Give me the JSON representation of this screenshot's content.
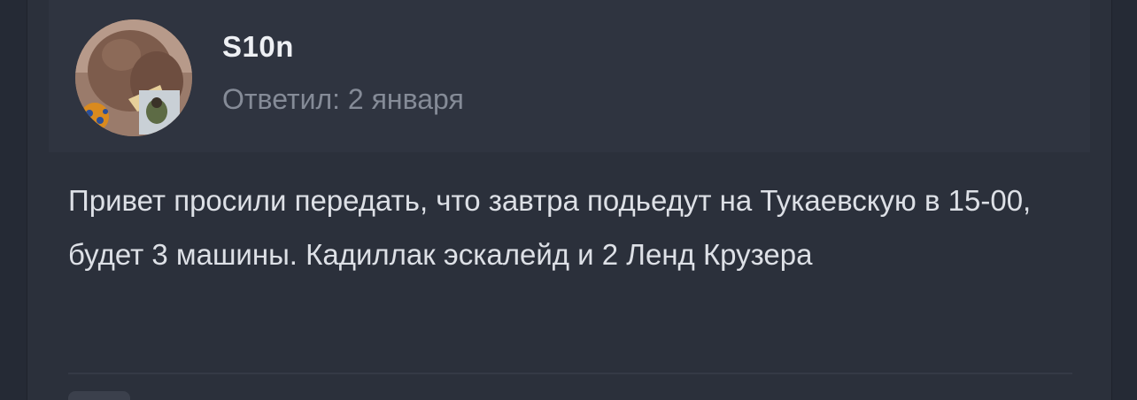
{
  "post": {
    "author": {
      "name": "S10n",
      "avatar_icon": "user-avatar-photo"
    },
    "reply_meta": "Ответил: 2 января",
    "body": "Привет просили передать, что завтра подьедут на Тукаевскую в 15-00, будет 3 машины. Кадиллак эскалейд и 2 Ленд Крузера"
  },
  "colors": {
    "background": "#252a35",
    "card": "#2b303b",
    "header": "#2f3440",
    "text": "#dde0e6",
    "muted": "#858b97"
  }
}
